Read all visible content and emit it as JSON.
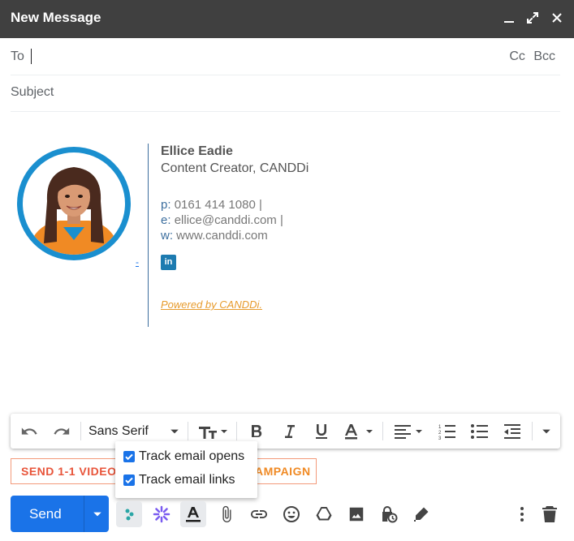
{
  "window": {
    "title": "New Message"
  },
  "fields": {
    "to_label": "To",
    "cc_label": "Cc",
    "bcc_label": "Bcc",
    "subject_label": "Subject"
  },
  "signature": {
    "name": "Ellice Eadie",
    "role": "Content Creator, CANDDi",
    "phone_key": "p:",
    "phone": "0161 414 1080 |",
    "email_key": "e:",
    "email": "ellice@canddi.com |",
    "web_key": "w:",
    "web": "www.canddi.com",
    "tiny_link": "-",
    "linkedin_glyph": "in",
    "powered_by": "Powered by CANDDi."
  },
  "toolbar": {
    "font_name": "Sans Serif"
  },
  "tracking": {
    "left_text": "SEND 1-1 VIDEO",
    "right_text": "AMPAIGN",
    "left_color": "#e8543a",
    "right_color": "#f08a24",
    "opens_label": "Track email opens",
    "links_label": "Track email links"
  },
  "send": {
    "label": "Send",
    "color": "#1a73e8"
  },
  "icons": {
    "minimize": "minimize-icon",
    "expand": "expand-icon",
    "close": "close-icon"
  }
}
